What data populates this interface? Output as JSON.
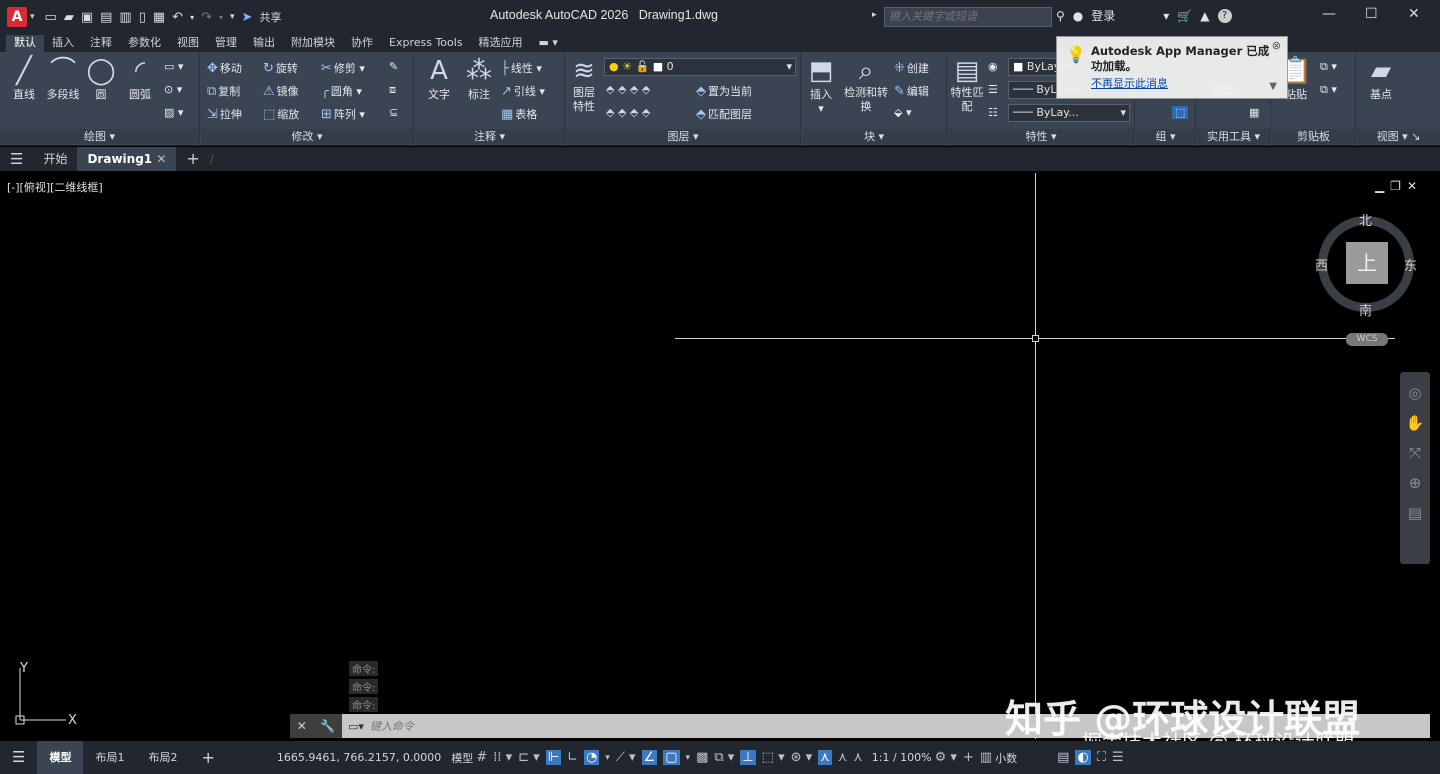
{
  "app": {
    "logo": "A",
    "title": "Autodesk AutoCAD 2026",
    "document": "Drawing1.dwg",
    "share": "共享"
  },
  "search": {
    "placeholder": "键入关键字或短语"
  },
  "account": {
    "login": "登录"
  },
  "ribbon_tabs": [
    "默认",
    "插入",
    "注释",
    "参数化",
    "视图",
    "管理",
    "输出",
    "附加模块",
    "协作",
    "Express Tools",
    "精选应用"
  ],
  "ribbon": {
    "draw": {
      "title": "绘图",
      "line": "直线",
      "polyline": "多段线",
      "circle": "圆",
      "arc": "圆弧"
    },
    "modify": {
      "title": "修改",
      "move": "移动",
      "rotate": "旋转",
      "trim": "修剪",
      "copy": "复制",
      "mirror": "镜像",
      "fillet": "圆角",
      "stretch": "拉伸",
      "scale": "缩放",
      "array": "阵列"
    },
    "annotation": {
      "title": "注释",
      "text": "文字",
      "dimension": "标注",
      "linear": "线性",
      "leader": "引线",
      "table": "表格"
    },
    "layers": {
      "title": "图层",
      "properties": "图层特性",
      "current_layer": "0",
      "make_current": "置为当前",
      "match_layer": "匹配图层"
    },
    "block": {
      "title": "块",
      "insert": "插入",
      "detect": "检测和转换",
      "create": "创建",
      "edit": "编辑"
    },
    "properties": {
      "title": "特性",
      "match": "特性匹配",
      "color": "ByLayer",
      "linetype": "ByLayer",
      "lineweight": "ByLay..."
    },
    "groups": {
      "title": "组"
    },
    "utilities": {
      "title": "实用工具",
      "measure": "测量"
    },
    "clipboard": {
      "title": "剪贴板",
      "paste": "粘贴"
    },
    "view": {
      "title": "视图",
      "base": "基点"
    }
  },
  "doc_tabs": {
    "start": "开始",
    "current": "Drawing1"
  },
  "viewport": {
    "label": "[-][俯视][二维线框]"
  },
  "viewcube": {
    "top": "上",
    "north": "北",
    "south": "南",
    "east": "东",
    "west": "西",
    "wcs": "WCS"
  },
  "ucs": {
    "x": "X",
    "y": "Y"
  },
  "command": {
    "history": [
      "命令:",
      "命令:",
      "命令:"
    ],
    "placeholder": "键入命令"
  },
  "status": {
    "model_tab": "模型",
    "layout1": "布局1",
    "layout2": "布局2",
    "coords": "1665.9461, 766.2157, 0.0000",
    "space": "模型",
    "scale": "1:1 / 100%",
    "units": "小数"
  },
  "toast": {
    "title": "Autodesk App Manager 已成功加载。",
    "link": "不再显示此消息"
  },
  "watermark": {
    "main": "知乎 @环球设计联盟",
    "sub": "掘金技术社区 @ 环球设计联盟"
  }
}
